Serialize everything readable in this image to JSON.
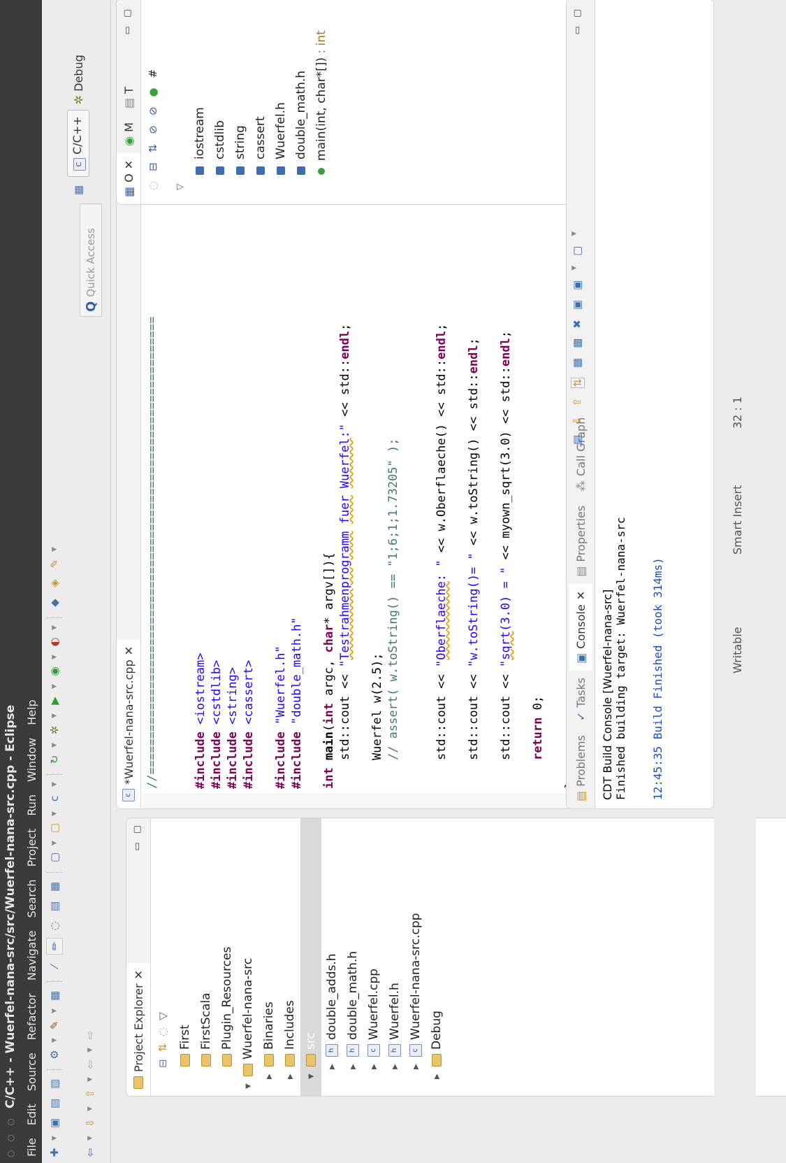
{
  "window": {
    "title": "C/C++ - Wuerfel-nana-src/src/Wuerfel-nana-src.cpp - Eclipse"
  },
  "menu": [
    "File",
    "Edit",
    "Source",
    "Refactor",
    "Navigate",
    "Search",
    "Project",
    "Run",
    "Window",
    "Help"
  ],
  "toolbar": {
    "quick_access_placeholder": "Quick Access",
    "perspective_cpp": "C/C++",
    "perspective_debug": "Debug"
  },
  "project_explorer": {
    "tab_label": "Project Explorer",
    "items": [
      {
        "label": "First",
        "indent": 1
      },
      {
        "label": "FirstScala",
        "indent": 1
      },
      {
        "label": "Plugin_Resources",
        "indent": 1
      },
      {
        "label": "Wuerfel-nana-src",
        "indent": 0
      },
      {
        "label": "Binaries",
        "indent": 1
      },
      {
        "label": "Includes",
        "indent": 1
      },
      {
        "label": "src",
        "indent": 1
      },
      {
        "label": "double_adds.h",
        "indent": 2
      },
      {
        "label": "double_math.h",
        "indent": 2
      },
      {
        "label": "Wuerfel.cpp",
        "indent": 2
      },
      {
        "label": "Wuerfel.h",
        "indent": 2
      },
      {
        "label": "Wuerfel-nana-src.cpp",
        "indent": 2
      },
      {
        "label": "Debug",
        "indent": 1
      }
    ]
  },
  "editor": {
    "tab_label": "*Wuerfel-nana-src.cpp"
  },
  "outline": {
    "items": [
      "iostream",
      "cstdlib",
      "string",
      "cassert",
      "Wuerfel.h",
      "double_math.h"
    ],
    "main_label": "main(int, char*[])",
    "main_return": " : int"
  },
  "console": {
    "tabs": [
      "Problems",
      "Tasks",
      "Console",
      "Properties",
      "Call Graph"
    ],
    "line1": "CDT Build Console [Wuerfel-nana-src]",
    "line2": "Finished building target: Wuerfel-nana-src",
    "line3": "12:45:35 Build Finished (took 314ms)"
  },
  "status": {
    "writable": "Writable",
    "insert_mode": "Smart Insert",
    "position": "32 : 1"
  }
}
